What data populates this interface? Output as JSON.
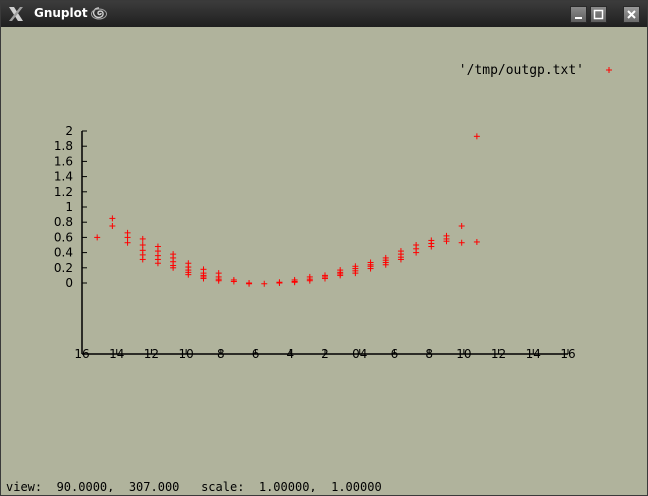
{
  "window": {
    "title": "Gnuplot",
    "app_icon": "x-logo-icon",
    "title_icon": "swirl-icon",
    "buttons": [
      "minimize-icon",
      "maximize-icon",
      "close-icon"
    ],
    "background": "#b0b39c"
  },
  "status": {
    "text": "view:  90.0000,  307.000   scale:  1.00000,  1.00000"
  },
  "chart_data": {
    "type": "scatter",
    "title": "",
    "xlabel": "",
    "ylabel": "",
    "marker": "+",
    "marker_color": "#ff0000",
    "legend": {
      "position": "top-right",
      "entries": [
        {
          "label": "'/tmp/outgp.txt'",
          "marker": "+",
          "color": "#ff0000"
        }
      ]
    },
    "x_tick_labels": [
      "16",
      "14",
      "12",
      "10",
      "8",
      "6",
      "4",
      "2",
      "04",
      "6",
      "8",
      "10",
      "12",
      "14",
      "16"
    ],
    "y_ticks": [
      0,
      0.2,
      0.4,
      0.6,
      0.8,
      1,
      1.2,
      1.4,
      1.6,
      1.8,
      2
    ],
    "y_tick_labels": [
      "0",
      "0.2",
      "0.4",
      "0.6",
      "0.8",
      "1",
      "1.2",
      "1.4",
      "1.6",
      "1.8",
      "2"
    ],
    "ylim": [
      0,
      2
    ],
    "xlim": [
      -16,
      16
    ],
    "series": [
      {
        "name": "'/tmp/outgp.txt'",
        "points": [
          [
            -15,
            0.6
          ],
          [
            -14,
            0.85
          ],
          [
            -14,
            0.75
          ],
          [
            -13,
            0.66
          ],
          [
            -13,
            0.6
          ],
          [
            -13,
            0.53
          ],
          [
            -12,
            0.58
          ],
          [
            -12,
            0.5
          ],
          [
            -12,
            0.43
          ],
          [
            -12,
            0.37
          ],
          [
            -12,
            0.31
          ],
          [
            -11,
            0.48
          ],
          [
            -11,
            0.42
          ],
          [
            -11,
            0.36
          ],
          [
            -11,
            0.31
          ],
          [
            -11,
            0.26
          ],
          [
            -10,
            0.38
          ],
          [
            -10,
            0.33
          ],
          [
            -10,
            0.28
          ],
          [
            -10,
            0.23
          ],
          [
            -10,
            0.2
          ],
          [
            -9,
            0.26
          ],
          [
            -9,
            0.21
          ],
          [
            -9,
            0.17
          ],
          [
            -9,
            0.14
          ],
          [
            -9,
            0.11
          ],
          [
            -8,
            0.18
          ],
          [
            -8,
            0.13
          ],
          [
            -8,
            0.1
          ],
          [
            -8,
            0.08
          ],
          [
            -8,
            0.06
          ],
          [
            -7,
            0.13
          ],
          [
            -7,
            0.08
          ],
          [
            -7,
            0.05
          ],
          [
            -7,
            0.03
          ],
          [
            -6,
            0.04
          ],
          [
            -6,
            0.02
          ],
          [
            -5,
            0.0
          ],
          [
            -5,
            -0.01
          ],
          [
            -4,
            -0.01
          ],
          [
            -3,
            0.0
          ],
          [
            -3,
            0.01
          ],
          [
            -2,
            0.04
          ],
          [
            -2,
            0.02
          ],
          [
            -2,
            0.01
          ],
          [
            -1,
            0.08
          ],
          [
            -1,
            0.05
          ],
          [
            -1,
            0.03
          ],
          [
            0,
            0.1
          ],
          [
            0,
            0.08
          ],
          [
            0,
            0.06
          ],
          [
            1,
            0.17
          ],
          [
            1,
            0.14
          ],
          [
            1,
            0.12
          ],
          [
            1,
            0.1
          ],
          [
            2,
            0.22
          ],
          [
            2,
            0.19
          ],
          [
            2,
            0.16
          ],
          [
            2,
            0.13
          ],
          [
            3,
            0.27
          ],
          [
            3,
            0.24
          ],
          [
            3,
            0.22
          ],
          [
            3,
            0.19
          ],
          [
            4,
            0.33
          ],
          [
            4,
            0.3
          ],
          [
            4,
            0.27
          ],
          [
            4,
            0.24
          ],
          [
            5,
            0.42
          ],
          [
            5,
            0.38
          ],
          [
            5,
            0.34
          ],
          [
            5,
            0.31
          ],
          [
            6,
            0.5
          ],
          [
            6,
            0.45
          ],
          [
            6,
            0.4
          ],
          [
            7,
            0.56
          ],
          [
            7,
            0.52
          ],
          [
            7,
            0.48
          ],
          [
            8,
            0.62
          ],
          [
            8,
            0.58
          ],
          [
            8,
            0.55
          ],
          [
            9,
            0.75
          ],
          [
            9,
            0.53
          ],
          [
            10,
            1.93
          ],
          [
            10,
            0.54
          ]
        ]
      }
    ]
  }
}
